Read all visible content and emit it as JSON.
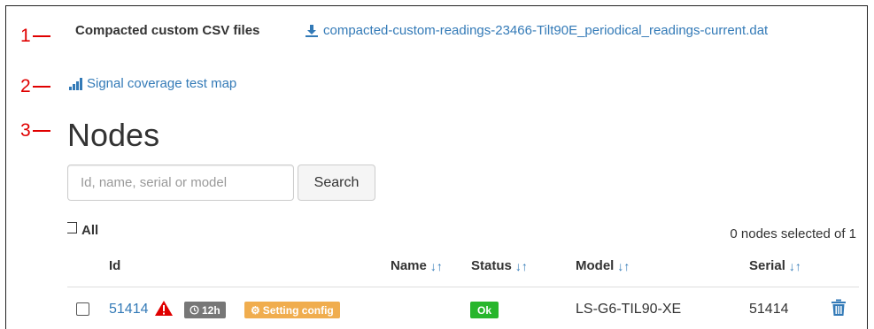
{
  "markers": [
    "1",
    "2",
    "3"
  ],
  "csv": {
    "label": "Compacted custom CSV files",
    "link": "compacted-custom-readings-23466-Tilt90E_periodical_readings-current.dat"
  },
  "signal_link": "Signal coverage test map",
  "nodes_title": "Nodes",
  "search": {
    "placeholder": "Id, name, serial or model",
    "value": "",
    "button": "Search"
  },
  "select_all_label": "All",
  "selected_count": "0 nodes selected of 1",
  "table": {
    "headers": {
      "id": "Id",
      "name": "Name",
      "status": "Status",
      "model": "Model",
      "serial": "Serial"
    },
    "sort_icon": "sort-arrows-icon",
    "rows": [
      {
        "id": "51414",
        "time_badge": "12h",
        "config_badge": "Setting config",
        "name": "",
        "status": "Ok",
        "model": "LS-G6-TIL90-XE",
        "serial": "51414"
      }
    ]
  },
  "colors": {
    "marker": "#e00000",
    "link": "#337ab7",
    "badge_time": "#777777",
    "badge_config": "#f0ad4e",
    "badge_ok": "#28b62c",
    "warning": "#e00000"
  }
}
